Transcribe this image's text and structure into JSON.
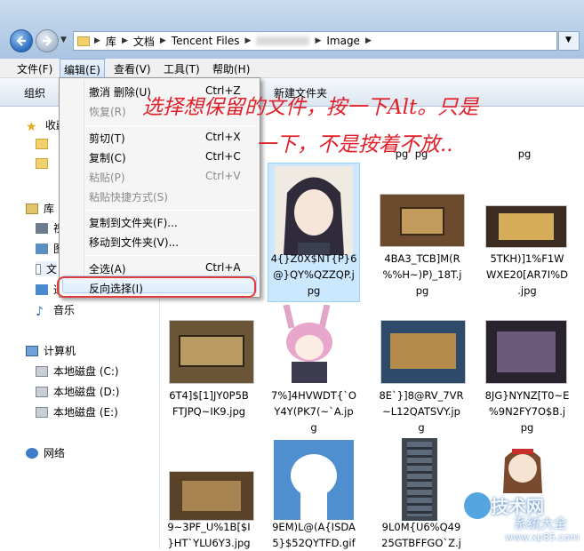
{
  "address": {
    "crumbs": [
      "库",
      "文档",
      "Tencent Files",
      "Image"
    ]
  },
  "menubar": [
    "文件(F)",
    "编辑(E)",
    "查看(V)",
    "工具(T)",
    "帮助(H)"
  ],
  "toolbar": {
    "organize": "组织",
    "new_folder": "新建文件夹"
  },
  "nav": {
    "favorites": "收藏",
    "libraries": "库",
    "library_items": [
      "视",
      "图",
      "文",
      "迅"
    ],
    "music": "音乐",
    "computer": "计算机",
    "drives": [
      "本地磁盘 (C:)",
      "本地磁盘 (D:)",
      "本地磁盘 (E:)"
    ],
    "network": "网络"
  },
  "edit_menu": {
    "items": [
      {
        "label": "撤消 删除(U)",
        "shortcut": "Ctrl+Z",
        "disabled": false
      },
      {
        "label": "恢复(R)",
        "shortcut": "",
        "disabled": true
      },
      {
        "label": "剪切(T)",
        "shortcut": "Ctrl+X",
        "disabled": false
      },
      {
        "label": "复制(C)",
        "shortcut": "Ctrl+C",
        "disabled": false
      },
      {
        "label": "粘贴(P)",
        "shortcut": "Ctrl+V",
        "disabled": true
      },
      {
        "label": "粘贴快捷方式(S)",
        "shortcut": "",
        "disabled": true
      },
      {
        "label": "复制到文件夹(F)...",
        "shortcut": "",
        "disabled": false
      },
      {
        "label": "移动到文件夹(V)...",
        "shortcut": "",
        "disabled": false
      },
      {
        "label": "全选(A)",
        "shortcut": "Ctrl+A",
        "disabled": false
      },
      {
        "label": "反向选择(I)",
        "shortcut": "",
        "disabled": false
      }
    ]
  },
  "files": [
    {
      "name1": "4{}Z0X$NT{P}6",
      "name2": "@}QY%QZZQP.j",
      "name3": "pg"
    },
    {
      "name1": "4BA3_TCB]M(R",
      "name2": "%%H~)P)_18T.j",
      "name3": "pg"
    },
    {
      "name1": "5TKH)]1%F1W",
      "name2": "WXE20[AR7I%D",
      "name3": ".jpg"
    },
    {
      "name1": "6T4]$[1]JY0P5B",
      "name2": "FTJPQ~IK9.jpg",
      "name3": ""
    },
    {
      "name1": "7%]4HVWDT{`O",
      "name2": "Y4Y(PK7(~`A.jp",
      "name3": "g"
    },
    {
      "name1": "8E`}]8@RV_7VR",
      "name2": "~L12QATSVY.jp",
      "name3": "g"
    },
    {
      "name1": "8JG}NYNZ[T0~E",
      "name2": "%9N2FY7O$B.j",
      "name3": "pg"
    },
    {
      "name1": "9~3PF_U%1B[$I",
      "name2": "}HT`YLU6Y3.jpg",
      "name3": ""
    },
    {
      "name1": "9EM)L@(A{ISDA",
      "name2": "5}$52QYTFD.gif",
      "name3": ""
    },
    {
      "name1": "9L0M{U6%Q49",
      "name2": "25GTBFFGO`Z.j",
      "name3": ""
    }
  ],
  "top_partial": [
    "pg",
    "pg",
    "pg"
  ],
  "annotation": {
    "line1": "选择想保留的文件，按一下Alt。只是",
    "line2": "一下，不是按着不放.."
  },
  "watermark": {
    "text": "技术网",
    "sub": "系统大全",
    "url": "www.xp85.com"
  }
}
